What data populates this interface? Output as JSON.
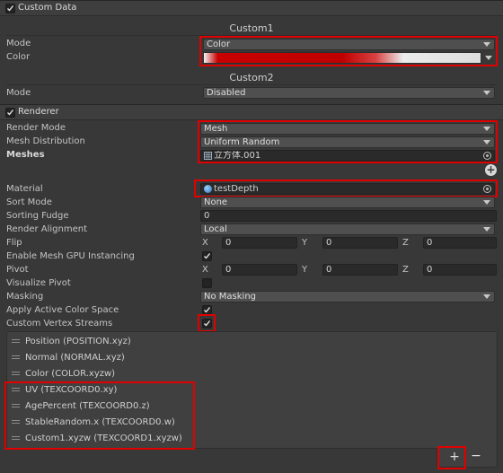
{
  "custom_data": {
    "title": "Custom Data",
    "custom1": {
      "title": "Custom1",
      "mode_label": "Mode",
      "mode_value": "Color",
      "color_label": "Color"
    },
    "custom2": {
      "title": "Custom2",
      "mode_label": "Mode",
      "mode_value": "Disabled"
    }
  },
  "renderer": {
    "title": "Renderer",
    "fields": {
      "render_mode": {
        "label": "Render Mode",
        "value": "Mesh"
      },
      "mesh_distribution": {
        "label": "Mesh Distribution",
        "value": "Uniform Random"
      },
      "meshes": {
        "label": "Meshes",
        "value": "立方体.001"
      },
      "material": {
        "label": "Material",
        "value": "testDepth"
      },
      "sort_mode": {
        "label": "Sort Mode",
        "value": "None"
      },
      "sorting_fudge": {
        "label": "Sorting Fudge",
        "value": "0"
      },
      "render_alignment": {
        "label": "Render Alignment",
        "value": "Local"
      },
      "flip": {
        "label": "Flip",
        "x": "0",
        "y": "0",
        "z": "0"
      },
      "gpu_instancing": {
        "label": "Enable Mesh GPU Instancing",
        "checked": true
      },
      "pivot": {
        "label": "Pivot",
        "x": "0",
        "y": "0",
        "z": "0"
      },
      "visualize_pivot": {
        "label": "Visualize Pivot",
        "checked": false
      },
      "masking": {
        "label": "Masking",
        "value": "No Masking"
      },
      "apply_active_color_space": {
        "label": "Apply Active Color Space",
        "checked": true
      },
      "custom_vertex_streams": {
        "label": "Custom Vertex Streams",
        "checked": true
      }
    },
    "axis": {
      "x": "X",
      "y": "Y",
      "z": "Z"
    },
    "streams": [
      "Position (POSITION.xyz)",
      "Normal (NORMAL.xyz)",
      "Color (COLOR.xyzw)",
      "UV (TEXCOORD0.xy)",
      "AgePercent (TEXCOORD0.z)",
      "StableRandom.x (TEXCOORD0.w)",
      "Custom1.xyzw (TEXCOORD1.xyzw)"
    ],
    "add_label": "+",
    "remove_label": "−"
  },
  "colors": {
    "highlight": "#e00000",
    "gradient_red": "#c80000"
  },
  "icons": [
    "checkbox-icon",
    "dropdown-arrow-icon",
    "mesh-grid-icon",
    "object-picker-icon",
    "material-sphere-icon",
    "drag-handle-icon",
    "add-icon"
  ]
}
